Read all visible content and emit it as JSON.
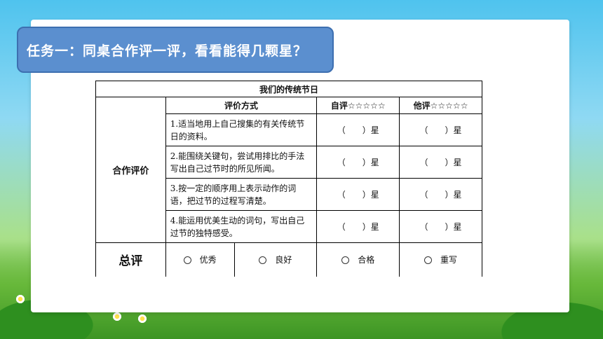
{
  "banner": {
    "text": "任务一：同桌合作评一评，看看能得几颗星？"
  },
  "table": {
    "title": "我们的传统节日",
    "headers": {
      "method": "评价方式",
      "self": "自评☆☆☆☆☆",
      "peer": "他评☆☆☆☆☆"
    },
    "group_label": "合作评价",
    "rows": [
      {
        "criterion": "1.适当地用上自己搜集的有关传统节日的资料。",
        "self": "（　　）星",
        "peer": "（　　）星"
      },
      {
        "criterion": "2.能围绕关键句，尝试用排比的手法写出自己过节时的所见所闻。",
        "self": "（　　）星",
        "peer": "（　　）星"
      },
      {
        "criterion": "3.按一定的顺序用上表示动作的词语，把过节的过程写清楚。",
        "self": "（　　）星",
        "peer": "（　　）星"
      },
      {
        "criterion": "4.能运用优美生动的词句，写出自己过节的独特感受。",
        "self": "（　　）星",
        "peer": "（　　）星"
      }
    ],
    "summary": {
      "label": "总评",
      "options": [
        "优秀",
        "良好",
        "合格",
        "重写"
      ]
    }
  }
}
